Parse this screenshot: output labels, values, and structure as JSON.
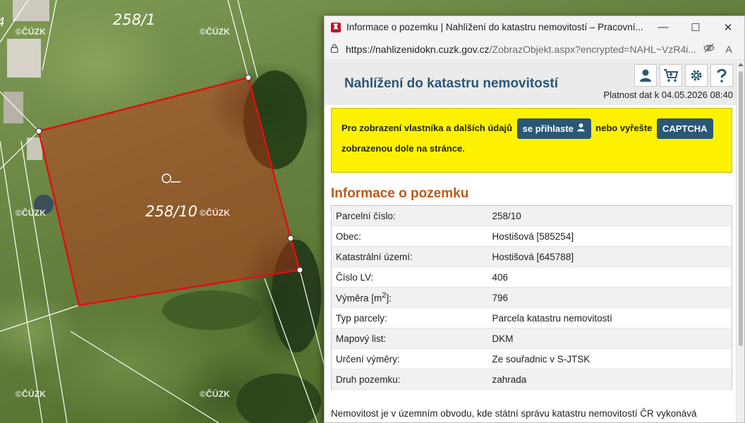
{
  "map": {
    "watermark": "©ČÚZK",
    "parcel_labels": {
      "north": "258/1",
      "selected": "258/10",
      "west_edge": "4"
    }
  },
  "window": {
    "title": "Informace o pozemku | Nahlížení do katastru nemovitostí – Pracovní...",
    "controls": {
      "minimize": "—",
      "maximize": "☐",
      "close": "✕"
    },
    "url_host": "https://nahlizenidokn.cuzk.gov.cz",
    "url_path": "/ZobrazObjekt.aspx?encrypted=NAHL~VzR4i...",
    "reader_icon": "A"
  },
  "page": {
    "site_title": "Nahlížení do katastru nemovitostí",
    "validity": "Platnost dat k 04.05.2026 08:40",
    "notice": {
      "text1": "Pro zobrazení vlastníka a dalších údajů",
      "login_button": "se přihlaste",
      "text2": "nebo vyřešte",
      "captcha_button": "CAPTCHA",
      "text3": "zobrazenou dole na stránce."
    },
    "section_title": "Informace o pozemku",
    "rows": [
      {
        "label": "Parcelní číslo:",
        "value": "258/10"
      },
      {
        "label": "Obec:",
        "value": "Hostišová [585254]"
      },
      {
        "label": "Katastrální území:",
        "value": "Hostišová [645788]"
      },
      {
        "label": "Číslo LV:",
        "value": "406"
      },
      {
        "label": "Výměra [m",
        "label_sup": "2",
        "label_tail": "]:",
        "value": "796"
      },
      {
        "label": "Typ parcely:",
        "value": "Parcela katastru nemovitostí"
      },
      {
        "label": "Mapový list:",
        "value": "DKM"
      },
      {
        "label": "Určení výměry:",
        "value": "Ze souřadnic v S-JTSK"
      },
      {
        "label": "Druh pozemku:",
        "value": "zahrada"
      }
    ],
    "footer_text": "Nemovitost je v územním obvodu, kde státní správu katastru nemovitostí ČR vykonává"
  },
  "colors": {
    "parcel_outline": "#e01010",
    "site_title": "#2b5777",
    "section_title": "#b85a1a",
    "notice_bg": "#fff200"
  }
}
